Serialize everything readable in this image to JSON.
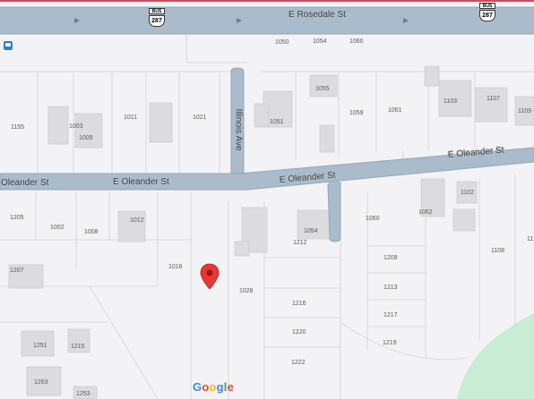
{
  "streets": {
    "rosedale": "E Rosedale St",
    "oleander_left_1": "Oleander St",
    "oleander_left_2": "E Oleander St",
    "oleander_mid": "E Oleander St",
    "oleander_right": "E Oleander St",
    "illinois": "Illinois Ave"
  },
  "route_shields": [
    {
      "top": "BUS",
      "number": "287"
    },
    {
      "top": "BUS",
      "number": "287"
    }
  ],
  "parcel_numbers": [
    "1050",
    "1054",
    "1060",
    "1055",
    "1103",
    "1107",
    "1109",
    "1155",
    "1003",
    "1009",
    "1011",
    "1021",
    "1051",
    "1059",
    "1061",
    "1102",
    "1062",
    "1205",
    "1002",
    "1008",
    "1012",
    "1060",
    "1054",
    "1212",
    "1209",
    "1108",
    "11",
    "1016",
    "1207",
    "1028",
    "1213",
    "1216",
    "1217",
    "1220",
    "1219",
    "1251",
    "1215",
    "1222",
    "1263",
    "1253"
  ],
  "branding": {
    "logo_letters": [
      "G",
      "o",
      "o",
      "g",
      "l",
      "e"
    ]
  },
  "colors": {
    "road": "#aabbcb",
    "road_edge": "#93a7ba",
    "background": "#f3f3f5",
    "building": "#dcdcde",
    "parcel_line": "#dadadd",
    "park": "#c9ecd4",
    "pin": "#e53935"
  },
  "icons": {
    "pin": "map-pin-icon",
    "transit": "bus-stop-icon"
  }
}
